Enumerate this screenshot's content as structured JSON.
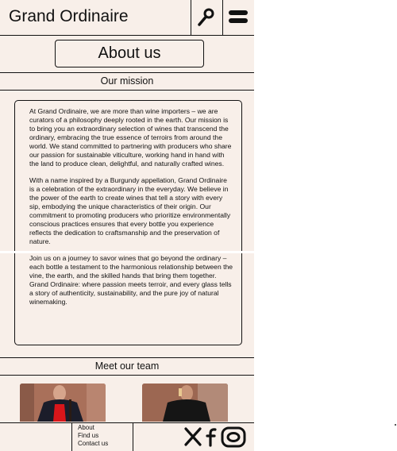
{
  "header": {
    "brand": "Grand Ordinaire",
    "search_icon": "search-icon",
    "menu_icon": "menu-icon"
  },
  "about_button": "About us",
  "mission": {
    "title": "Our mission",
    "paragraphs": [
      "At Grand Ordinaire, we are more than wine importers – we are curators of a philosophy deeply rooted in the earth. Our mission is to bring you an extraordinary selection of wines that transcend the ordinary, embracing the true essence of terroirs from around the world. We stand committed to partnering with producers who share our passion for sustainable viticulture, working hand in hand with the land to produce clean, delightful, and naturally crafted wines.",
      "With a name inspired by a Burgundy appellation, Grand Ordinaire is a celebration of the extraordinary in the everyday. We believe in the power of the earth to create wines that tell a story with every sip, embodying the unique characteristics of their origin. Our commitment to promoting producers who prioritize environmentally conscious practices ensures that every bottle you experience reflects the dedication to craftsmanship and the preservation of nature.",
      "Join us on a journey to savor wines that go beyond the ordinary – each bottle a testament to the harmonious relationship between the vine, the earth, and the skilled hands that bring them together. Grand Ordinaire: where passion meets terroir, and every glass tells a story of authenticity, sustainability, and the pure joy of natural winemaking."
    ]
  },
  "team": {
    "title": "Meet our team"
  },
  "footer": {
    "links": [
      "About",
      "Find us",
      "Contact us"
    ],
    "social_icons": [
      "x-icon",
      "facebook-icon",
      "instagram-icon"
    ]
  }
}
